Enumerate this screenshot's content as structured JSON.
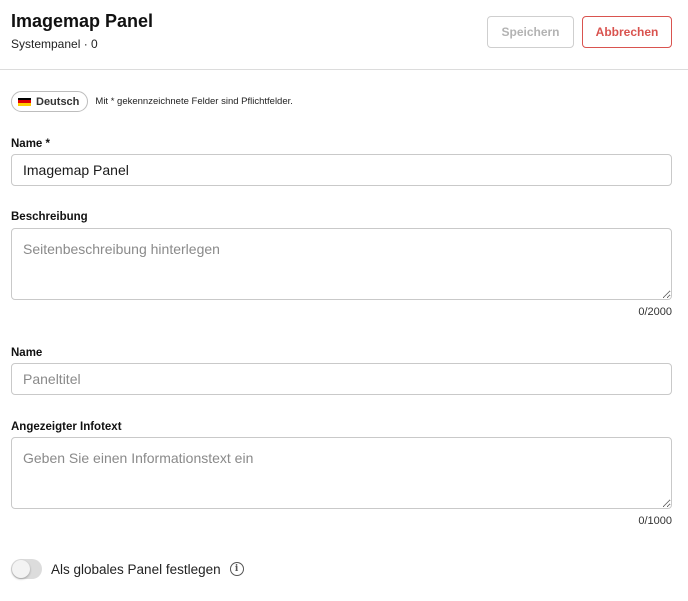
{
  "header": {
    "title": "Imagemap Panel",
    "subtitle": "Systempanel · 0",
    "save_label": "Speichern",
    "cancel_label": "Abbrechen"
  },
  "language": {
    "label": "Deutsch",
    "icon": "flag-de-icon",
    "required_note": "Mit * gekennzeichnete Felder sind Pflichtfelder."
  },
  "form": {
    "name": {
      "label": "Name *",
      "value": "Imagemap Panel"
    },
    "description": {
      "label": "Beschreibung",
      "placeholder": "Seitenbeschreibung hinterlegen",
      "counter": "0/2000"
    },
    "panel_title": {
      "label": "Name",
      "placeholder": "Paneltitel"
    },
    "info_text": {
      "label": "Angezeigter Infotext",
      "placeholder": "Geben Sie einen Informationstext ein",
      "counter": "0/1000"
    },
    "global_toggle": {
      "label": "Als globales Panel festlegen",
      "checked": false,
      "info_icon": "info-icon"
    }
  },
  "colors": {
    "accent": "#d9534f",
    "disabled_text": "#b3b3b3",
    "border": "#c9c9c9"
  }
}
